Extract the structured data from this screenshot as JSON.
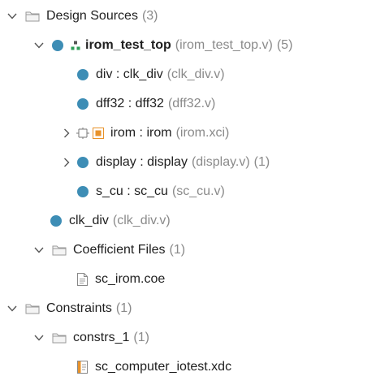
{
  "tree": {
    "design_sources": {
      "label": "Design Sources",
      "count": "(3)"
    },
    "top": {
      "name": "irom_test_top",
      "detail": "(irom_test_top.v)",
      "count": "(5)"
    },
    "div": {
      "name": "div : clk_div",
      "detail": "(clk_div.v)"
    },
    "dff32": {
      "name": "dff32 : dff32",
      "detail": "(dff32.v)"
    },
    "irom": {
      "name": "irom : irom",
      "detail": "(irom.xci)"
    },
    "display": {
      "name": "display : display",
      "detail": "(display.v)",
      "count": "(1)"
    },
    "scu": {
      "name": "s_cu : sc_cu",
      "detail": "(sc_cu.v)"
    },
    "clk_div": {
      "name": "clk_div",
      "detail": "(clk_div.v)"
    },
    "coefficient_files": {
      "label": "Coefficient Files",
      "count": "(1)"
    },
    "coe": {
      "name": "sc_irom.coe"
    },
    "constraints": {
      "label": "Constraints",
      "count": "(1)"
    },
    "constrs": {
      "label": "constrs_1",
      "count": "(1)"
    },
    "xdc": {
      "name": "sc_computer_iotest.xdc"
    }
  },
  "icons": {
    "folder": "folder-icon",
    "verilog_module": "module-dot-icon",
    "hierarchy": "hierarchy-icon",
    "ip_core": "ip-core-icon",
    "text_file": "text-file-icon",
    "constraint_file": "constraint-file-icon"
  },
  "colors": {
    "module_dot": "#3d8db5",
    "hierarchy_green": "#2e9e57",
    "ip_orange": "#e8922a",
    "muted_text": "#8a8a8a"
  }
}
